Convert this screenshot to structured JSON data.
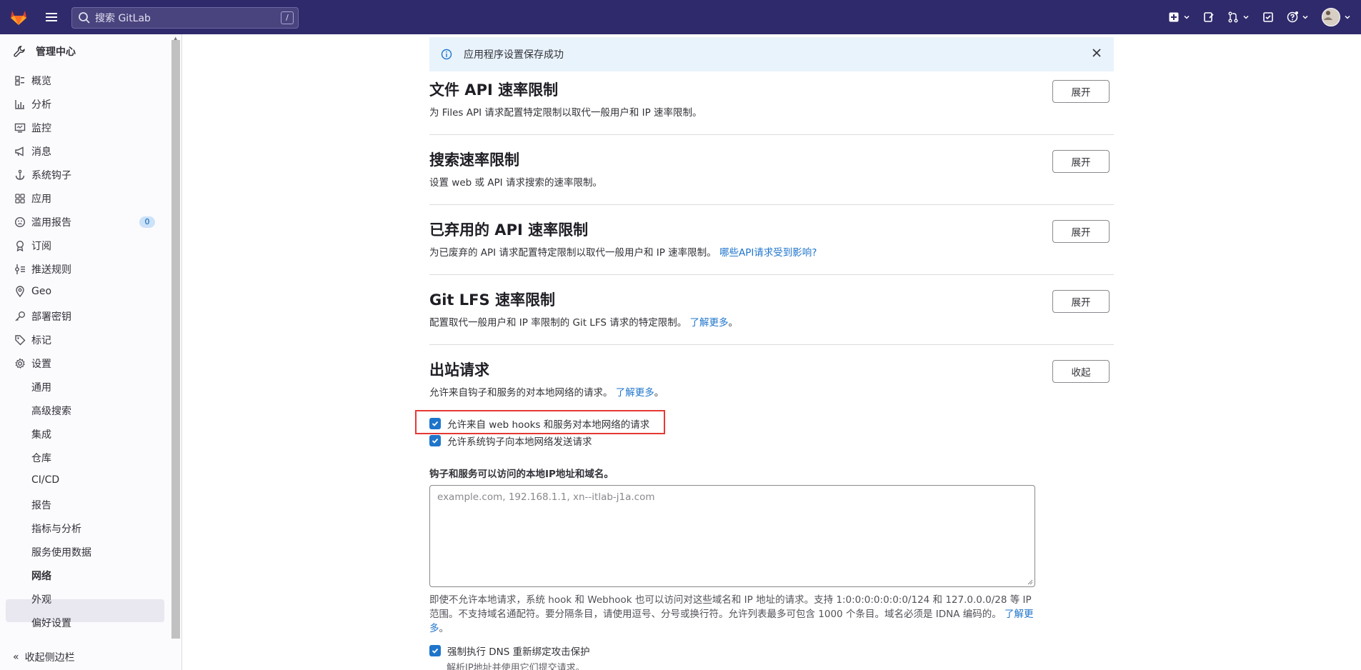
{
  "topbar": {
    "search_placeholder": "搜索 GitLab",
    "search_shortcut": "/"
  },
  "sidebar": {
    "title": "管理中心",
    "items": [
      {
        "label": "概览",
        "icon": "overview-icon"
      },
      {
        "label": "分析",
        "icon": "analytics-icon"
      },
      {
        "label": "监控",
        "icon": "monitor-icon"
      },
      {
        "label": "消息",
        "icon": "bullhorn-icon"
      },
      {
        "label": "系统钩子",
        "icon": "anchor-icon"
      },
      {
        "label": "应用",
        "icon": "applications-icon"
      },
      {
        "label": "滥用报告",
        "icon": "slight-frown-icon",
        "badge": "0"
      },
      {
        "label": "订阅",
        "icon": "subscription-icon"
      },
      {
        "label": "推送规则",
        "icon": "push-rules-icon"
      },
      {
        "label": "Geo",
        "icon": "location-icon"
      },
      {
        "label": "部署密钥",
        "icon": "key-icon"
      },
      {
        "label": "标记",
        "icon": "label-icon"
      },
      {
        "label": "设置",
        "icon": "settings-icon"
      }
    ],
    "settings_subitems": [
      "通用",
      "高级搜索",
      "集成",
      "仓库",
      "CI/CD",
      "报告",
      "指标与分析",
      "服务使用数据",
      "网络",
      "外观",
      "偏好设置"
    ],
    "active_subitem": "网络",
    "collapse_label": "收起侧边栏"
  },
  "alert": {
    "message": "应用程序设置保存成功"
  },
  "sections": [
    {
      "title": "文件 API 速率限制",
      "description": "为 Files API 请求配置特定限制以取代一般用户和 IP 速率限制。",
      "link": "",
      "button": "展开"
    },
    {
      "title": "搜索速率限制",
      "description": "设置 web 或 API 请求搜索的速率限制。",
      "link": "",
      "button": "展开"
    },
    {
      "title": "已弃用的 API 速率限制",
      "description": "为已废弃的 API 请求配置特定限制以取代一般用户和 IP 速率限制。",
      "link": "哪些API请求受到影响?",
      "button": "展开"
    },
    {
      "title": "Git LFS 速率限制",
      "description": "配置取代一般用户和 IP 率限制的 Git LFS 请求的特定限制。",
      "link": "了解更多",
      "link_suffix": "。",
      "button": "展开"
    },
    {
      "title": "出站请求",
      "description": "允许来自钩子和服务的对本地网络的请求。",
      "link": "了解更多",
      "link_suffix": "。",
      "button": "收起"
    }
  ],
  "outbound": {
    "checkbox_webhooks": "允许来自 web hooks 和服务对本地网络的请求",
    "checkbox_system_hooks": "允许系统钩子向本地网络发送请求",
    "allowlist_label": "钩子和服务可以访问的本地IP地址和域名。",
    "allowlist_placeholder": "example.com, 192.168.1.1, xn--itlab-j1a.com",
    "help_text": "即使不允许本地请求，系统 hook 和 Webhook 也可以访问对这些域名和 IP 地址的请求。支持 1:0:0:0:0:0:0:0/124 和 127.0.0.0/28 等 IP 范围。不支持域名通配符。要分隔条目，请使用逗号、分号或换行符。允许列表最多可包含 1000 个条目。域名必须是 IDNA 编码的。",
    "help_link": "了解更多",
    "help_suffix": "。",
    "checkbox_dns": "强制执行 DNS 重新绑定攻击保护",
    "dns_help": "解析IP地址并使用它们提交请求。"
  },
  "colors": {
    "navbar": "#2f2a6b",
    "accent": "#1f75cb",
    "highlight_box": "#e53935"
  }
}
